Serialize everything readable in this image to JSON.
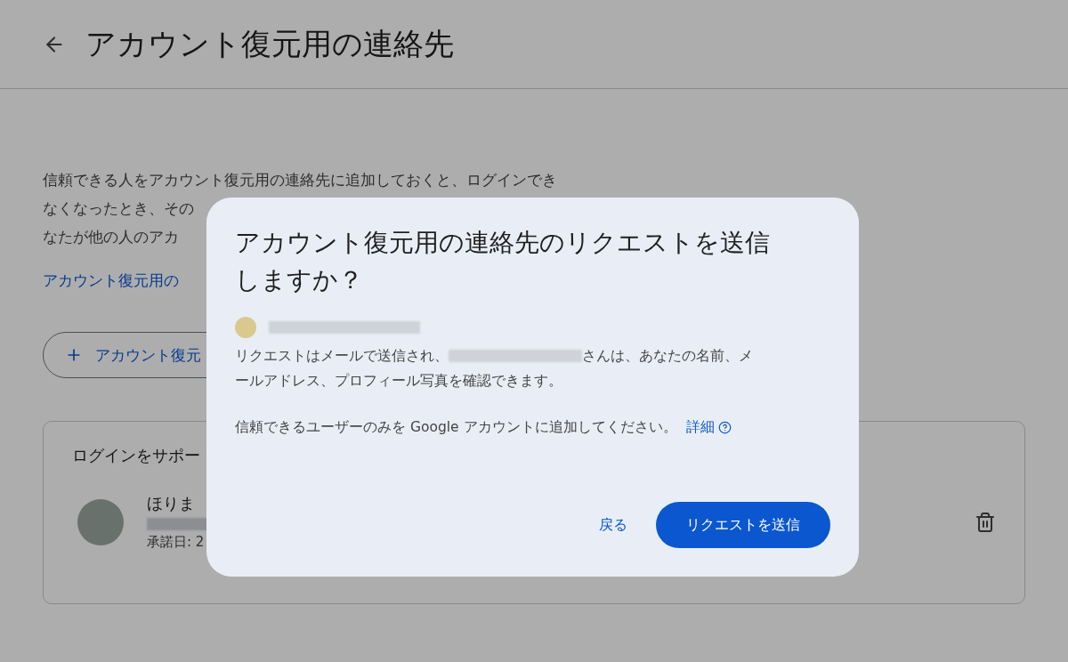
{
  "page": {
    "title": "アカウント復元用の連絡先",
    "description_lines": [
      "信頼できる人をアカウント復元用の連絡先に追加しておくと、ログインでき",
      "なくなったとき、その",
      "なたが他の人のアカ"
    ],
    "link": "アカウント復元用の",
    "add_button": "アカウント復元"
  },
  "card": {
    "title": "ログインをサポー",
    "contact": {
      "name": "ほりま",
      "accepted": "承諾日: 2"
    }
  },
  "dialog": {
    "title": "アカウント復元用の連絡先のリクエストを送信しますか？",
    "body_before": "リクエストはメールで送信され、",
    "body_after": "さんは、あなたの名前、メ",
    "body_line2": "ールアドレス、プロフィール写真を確認できます。",
    "note": "信頼できるユーザーのみを Google アカウントに追加してください。",
    "link": "詳細",
    "buttons": [
      {
        "label": "戻る",
        "kind": "text"
      },
      {
        "label": "リクエストを送信",
        "kind": "filled"
      }
    ]
  }
}
